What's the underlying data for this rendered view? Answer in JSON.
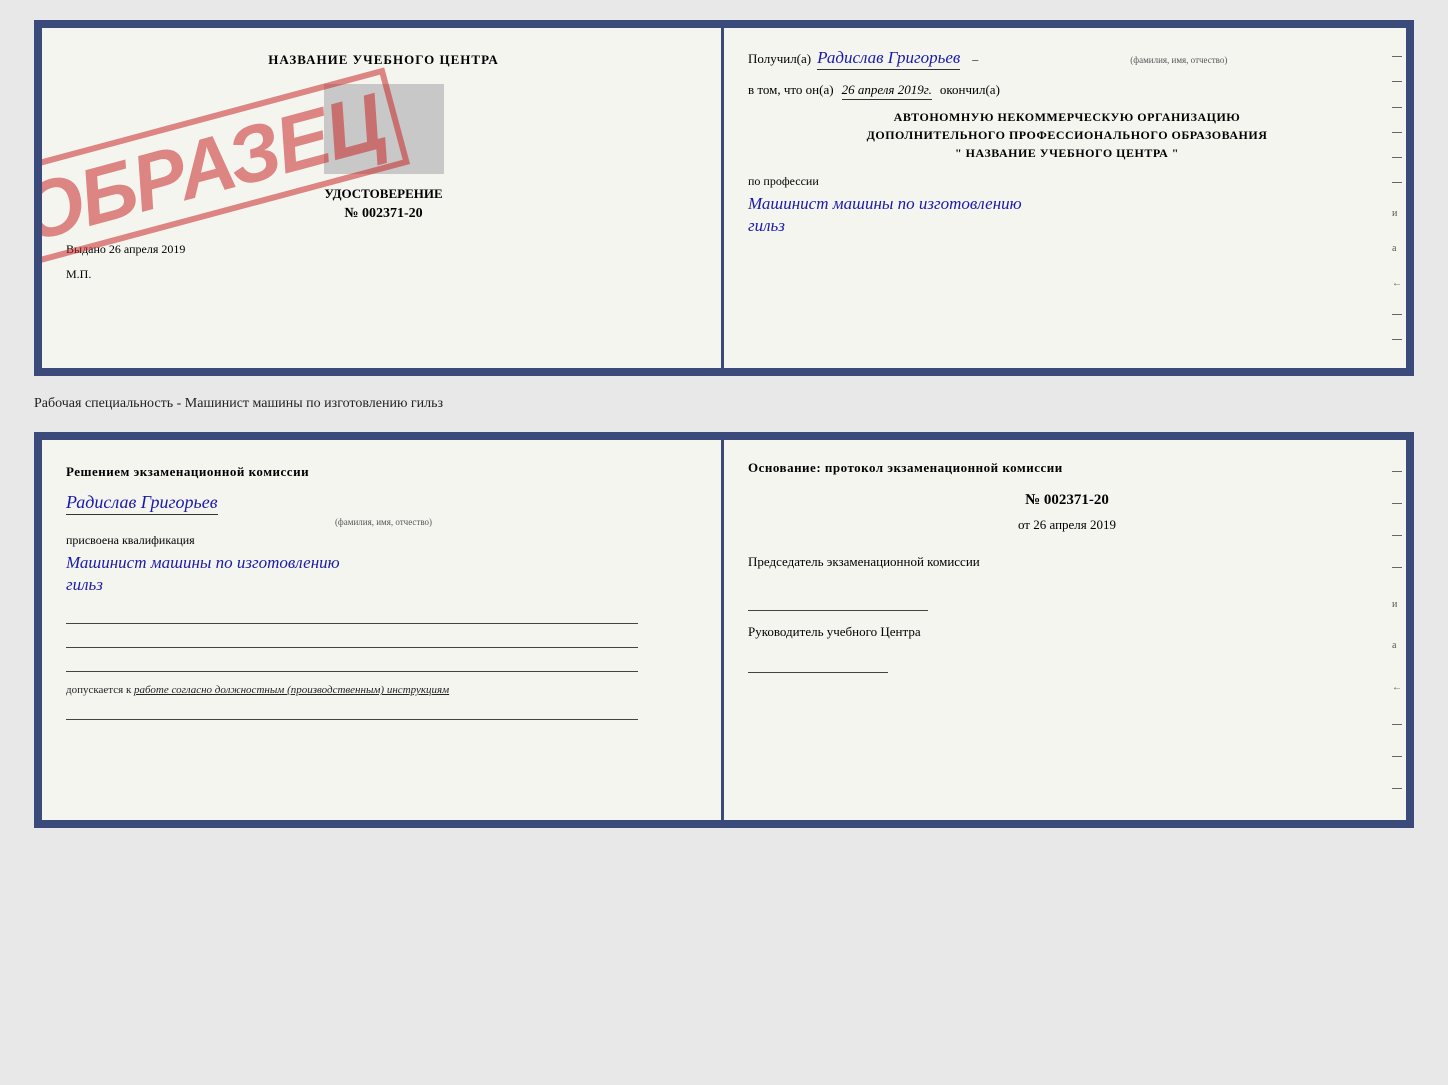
{
  "topDoc": {
    "left": {
      "centerName": "НАЗВАНИЕ УЧЕБНОГО ЦЕНТРА",
      "udostoverenie": "УДОСТОВЕРЕНИЕ",
      "number": "№ 002371-20",
      "vydano": "Выдано",
      "vydanoDate": "26 апреля 2019",
      "mp": "М.П.",
      "obrazec": "ОБРАЗЕЦ"
    },
    "right": {
      "poluchilLabel": "Получил(а)",
      "recipientName": "Радислав Григорьев",
      "fioLabel": "(фамилия, имя, отчество)",
      "vtomChtoOn": "в том, что он(а)",
      "date": "26 апреля 2019г.",
      "okonchilLabel": "окончил(а)",
      "orgLine1": "АВТОНОМНУЮ НЕКОММЕРЧЕСКУЮ ОРГАНИЗАЦИЮ",
      "orgLine2": "ДОПОЛНИТЕЛЬНОГО ПРОФЕССИОНАЛЬНОГО ОБРАЗОВАНИЯ",
      "orgLine3": "\" НАЗВАНИЕ УЧЕБНОГО ЦЕНТРА \"",
      "poProfessii": "по профессии",
      "professionCursive1": "Машинист машины по изготовлению",
      "professionCursive2": "гильз"
    }
  },
  "separatorLabel": "Рабочая специальность - Машинист машины по изготовлению гильз",
  "bottomDoc": {
    "left": {
      "resheniemTitle": "Решением  экзаменационной  комиссии",
      "recipientName": "Радислав Григорьев",
      "fioLabel": "(фамилия, имя, отчество)",
      "prisvoenaLabel": "присвоена квалификация",
      "qualificationCursive1": "Машинист  машины  по  изготовлению",
      "qualificationCursive2": "гильз",
      "dopuskaetsya": "допускается к",
      "dopuskaetsyaItalic": "работе согласно должностным (производственным) инструкциям"
    },
    "right": {
      "osnovanieTitleLabel": "Основание: протокол экзаменационной  комиссии",
      "protocolNumber": "№  002371-20",
      "otLabel": "от",
      "date": "26 апреля 2019",
      "predsedatelTitle": "Председатель экзаменационной комиссии",
      "rukovoditelTitle": "Руководитель учебного Центра"
    }
  }
}
